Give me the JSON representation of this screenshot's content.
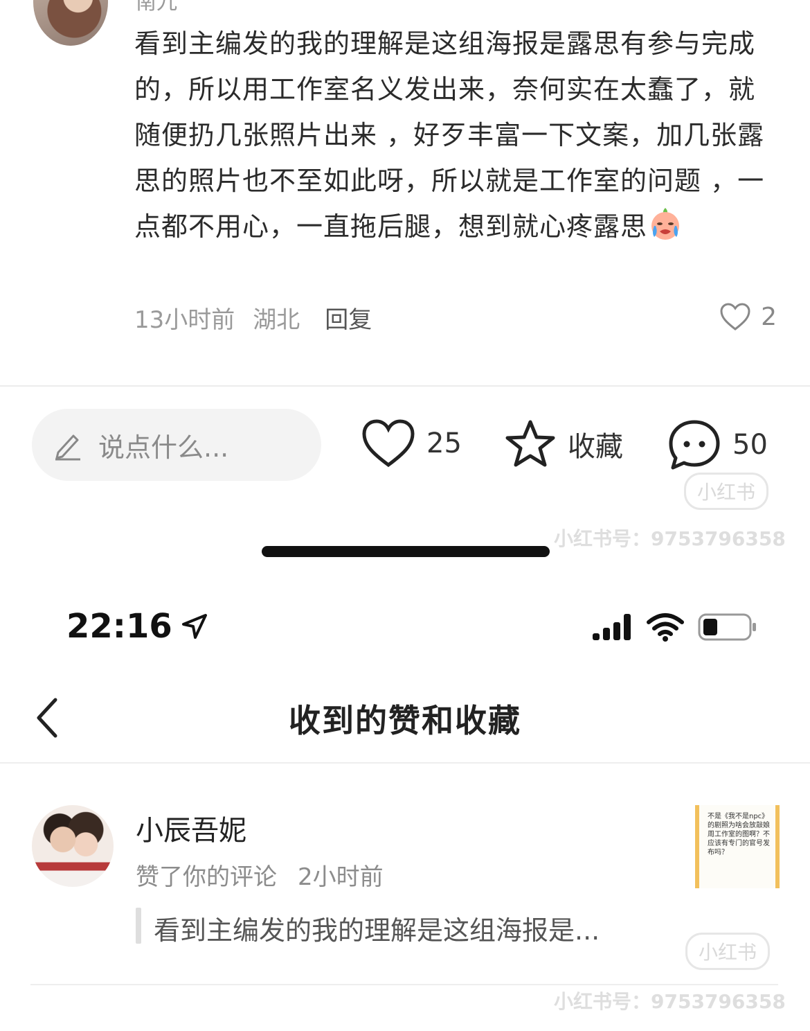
{
  "comment": {
    "author_partial": "南九",
    "text": "看到主编发的我的理解是这组海报是露思有参与完成的，所以用工作室名义发出来，奈何实在太蠢了，就随便扔几张照片出来 ，好歹丰富一下文案，加几张露思的照片也不至如此呀，所以就是工作室的问题 ，一点都不用心，一直拖后腿，想到就心疼露思",
    "emoji": "crying-emoji",
    "time": "13小时前",
    "location": "湖北",
    "reply_label": "回复",
    "likes": "2"
  },
  "action_bar": {
    "input_placeholder": "说点什么...",
    "like_count": "25",
    "favorite_label": "收藏",
    "comment_count": "50"
  },
  "watermark": {
    "brand": "小红书",
    "id_text": "小红书号：9753796358"
  },
  "status_bar": {
    "time": "22:16"
  },
  "header": {
    "title": "收到的赞和收藏"
  },
  "notification": {
    "user": "小辰吾妮",
    "action": "赞了你的评论",
    "time": "2小时前",
    "quote": "看到主编发的我的理解是这组海报是...",
    "thumbnail_text": "不是《我不是npc》的剧照为啥会放敲娘周工作室的图啊？不应该有专门的官号发布吗？"
  },
  "colors": {
    "text": "#222222",
    "muted": "#9a9a9a",
    "thumb_border": "#f2c05c"
  }
}
